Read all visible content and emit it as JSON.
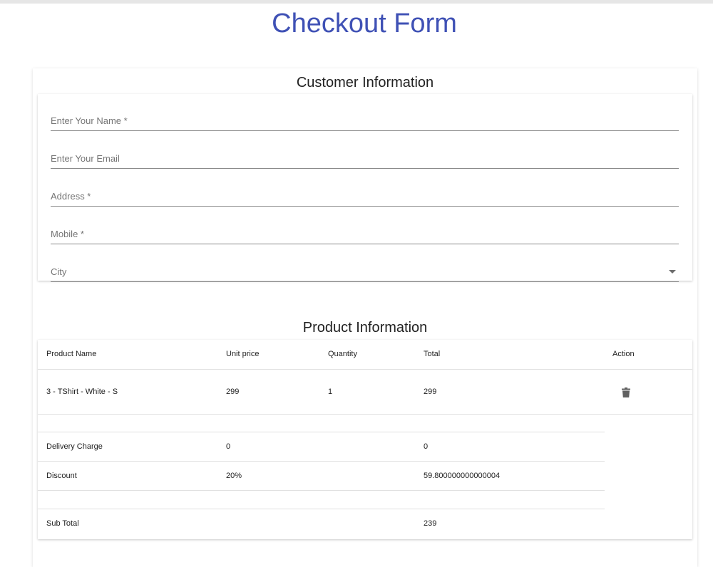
{
  "page": {
    "title": "Checkout Form"
  },
  "customer": {
    "title": "Customer Information",
    "fields": {
      "name": "Enter Your Name *",
      "email": "Enter Your Email",
      "address": "Address *",
      "mobile": "Mobile *",
      "city": "City"
    }
  },
  "product": {
    "title": "Product Information",
    "headers": [
      "Product Name",
      "Unit price",
      "Quantity",
      "Total",
      "Action"
    ],
    "rows": [
      {
        "name": "3 - TShirt - White - S",
        "unit_price": "299",
        "quantity": "1",
        "total": "299",
        "action_icon": "trash-icon"
      }
    ],
    "summary": {
      "delivery": {
        "label": "Delivery Charge",
        "value": "0",
        "total": "0"
      },
      "discount": {
        "label": "Discount",
        "value": "20%",
        "total": "59.800000000000004"
      },
      "subtotal": {
        "label": "Sub Total",
        "total": "239"
      }
    }
  }
}
